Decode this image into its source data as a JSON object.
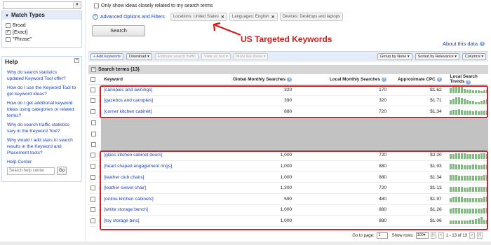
{
  "match_types": {
    "title": "Match Types",
    "options": [
      {
        "label": "Broad",
        "checked": false
      },
      {
        "label": "[Exact]",
        "checked": true
      },
      {
        "label": "\"Phrase\"",
        "checked": false
      }
    ]
  },
  "help": {
    "title": "Help",
    "links": [
      "Which data do search statistics",
      "How do I use the Keyword Tool to get keyword ideas?",
      "How do I get additional keyword ideas using categories or related terms?",
      "Why do search traffic statistics vary in the Keyword Tool?",
      "Why would I add stars to search results in the Keyword and Placement tools?",
      "Help Center"
    ],
    "search_placeholder": "Search help center",
    "go_label": "Go"
  },
  "options": {
    "closely_related_label": "Only show ideas closely related to my search terms",
    "advanced_label": "Advanced Options and Filters",
    "chips": [
      {
        "label": "Locations: United States"
      },
      {
        "label": "Languages: English"
      },
      {
        "label": "Devices: Desktops and laptops"
      }
    ]
  },
  "search_button": "Search",
  "annotation": "US Targeted Keywords",
  "about_link": "About this data",
  "toolbar": {
    "add_keywords": "+ Add keywords",
    "download": "Download ▾",
    "estimate": "Estimate search traffic",
    "view_as_text": "View as text ▾",
    "more_like_these": "More like these ▾",
    "group_by": "Group by None ▾",
    "sorted_by": "Sorted by Relevance ▾",
    "columns": "Columns ▾"
  },
  "section_title": "Search terms (13)",
  "table": {
    "headers": {
      "keyword": "Keyword",
      "global": "Global Monthly Searches",
      "local": "Local Monthly Searches",
      "cpc": "Approximate CPC",
      "trends": "Local Search Trends"
    },
    "rows_top": [
      {
        "keyword": "[canopies and awnings]",
        "global": "320",
        "local": "170",
        "cpc": "$1.62",
        "trend": [
          7,
          8,
          9,
          9,
          8,
          6,
          5,
          5,
          4,
          4,
          4,
          3,
          4,
          5
        ]
      },
      {
        "keyword": "[gazebos and canopies]",
        "global": "390",
        "local": "320",
        "cpc": "$1.71",
        "trend": [
          5,
          7,
          9,
          9,
          8,
          7,
          5,
          4,
          4,
          3,
          3,
          4,
          5,
          6
        ]
      },
      {
        "keyword": "[corner kitchen cabinet]",
        "global": "880",
        "local": "720",
        "cpc": "$1.34",
        "trend": [
          6,
          7,
          7,
          8,
          7,
          6,
          6,
          6,
          5,
          6,
          5,
          6,
          6,
          6
        ]
      }
    ],
    "rows_bottom": [
      {
        "keyword": "[glass kitchen cabinet doors]",
        "global": "1,000",
        "local": "720",
        "cpc": "$2.20",
        "trend": [
          6,
          6,
          7,
          7,
          7,
          7,
          6,
          6,
          6,
          6,
          6,
          7,
          7,
          6
        ]
      },
      {
        "keyword": "[heart shaped engagement rings]",
        "global": "1,000",
        "local": "880",
        "cpc": "$1.93",
        "trend": [
          8,
          8,
          7,
          7,
          7,
          6,
          6,
          6,
          7,
          7,
          6,
          6,
          7,
          7
        ]
      },
      {
        "keyword": "[leather club chairs]",
        "global": "1,000",
        "local": "880",
        "cpc": "$1.34",
        "trend": [
          7,
          7,
          7,
          6,
          6,
          6,
          6,
          6,
          6,
          6,
          6,
          6,
          7,
          7
        ]
      },
      {
        "keyword": "[leather swivel chair]",
        "global": "1,300",
        "local": "720",
        "cpc": "$1.13",
        "trend": [
          6,
          6,
          6,
          6,
          6,
          5,
          5,
          6,
          6,
          6,
          6,
          6,
          6,
          6
        ]
      },
      {
        "keyword": "[online kitchen cabinets]",
        "global": "590",
        "local": "480",
        "cpc": "$1.97",
        "trend": [
          6,
          7,
          7,
          7,
          7,
          6,
          6,
          6,
          6,
          6,
          6,
          6,
          7,
          7
        ]
      },
      {
        "keyword": "[white storage bench]",
        "global": "1,000",
        "local": "880",
        "cpc": "$1.26",
        "trend": [
          6,
          7,
          7,
          7,
          6,
          6,
          6,
          6,
          6,
          6,
          6,
          6,
          7,
          7
        ]
      },
      {
        "keyword": "[toy storage bins]",
        "global": "1,000",
        "local": "880",
        "cpc": "$1.06",
        "trend": [
          5,
          5,
          5,
          5,
          5,
          5,
          5,
          6,
          6,
          7,
          8,
          9,
          6,
          6
        ]
      }
    ]
  },
  "footer": {
    "goto_label": "Go to page:",
    "page_value": "1",
    "show_rows_label": "Show rows:",
    "rows_value": "100",
    "range_label": "1 - 13 of 13"
  },
  "colors": {
    "link": "#1a3fb5",
    "highlight": "#d41f2a",
    "trend_bar": "#72c472",
    "panel": "#e5ecf9"
  }
}
